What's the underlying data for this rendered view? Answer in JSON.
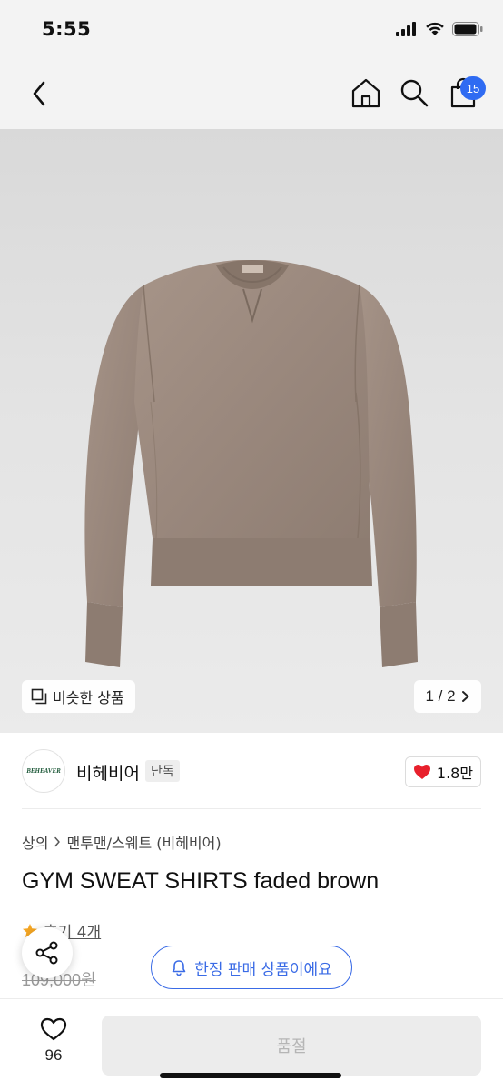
{
  "status_bar": {
    "time": "5:55"
  },
  "nav": {
    "cart_count": "15"
  },
  "product_image": {
    "alt": "GYM SWEAT SHIRTS faded brown",
    "similar_label": "비슷한 상품",
    "page_indicator": "1 / 2"
  },
  "brand": {
    "logo_text": "BEHEAVER",
    "name": "비헤비어",
    "tag": "단독",
    "likes": "1.8만"
  },
  "breadcrumb": {
    "level1": "상의",
    "level2": "맨투맨/스웨트 (비헤비어)"
  },
  "product": {
    "title": "GYM SWEAT SHIRTS faded brown",
    "review_label": "후기 4개",
    "original_price": "109,000원"
  },
  "limited_badge": "한정 판매 상품이에요",
  "bottom_bar": {
    "wish_count": "96",
    "cta_label": "품절"
  },
  "colors": {
    "accent": "#3a6be6",
    "badge": "#2f6bf2",
    "heart": "#e8202c",
    "sweatshirt": "#9c8b80"
  }
}
